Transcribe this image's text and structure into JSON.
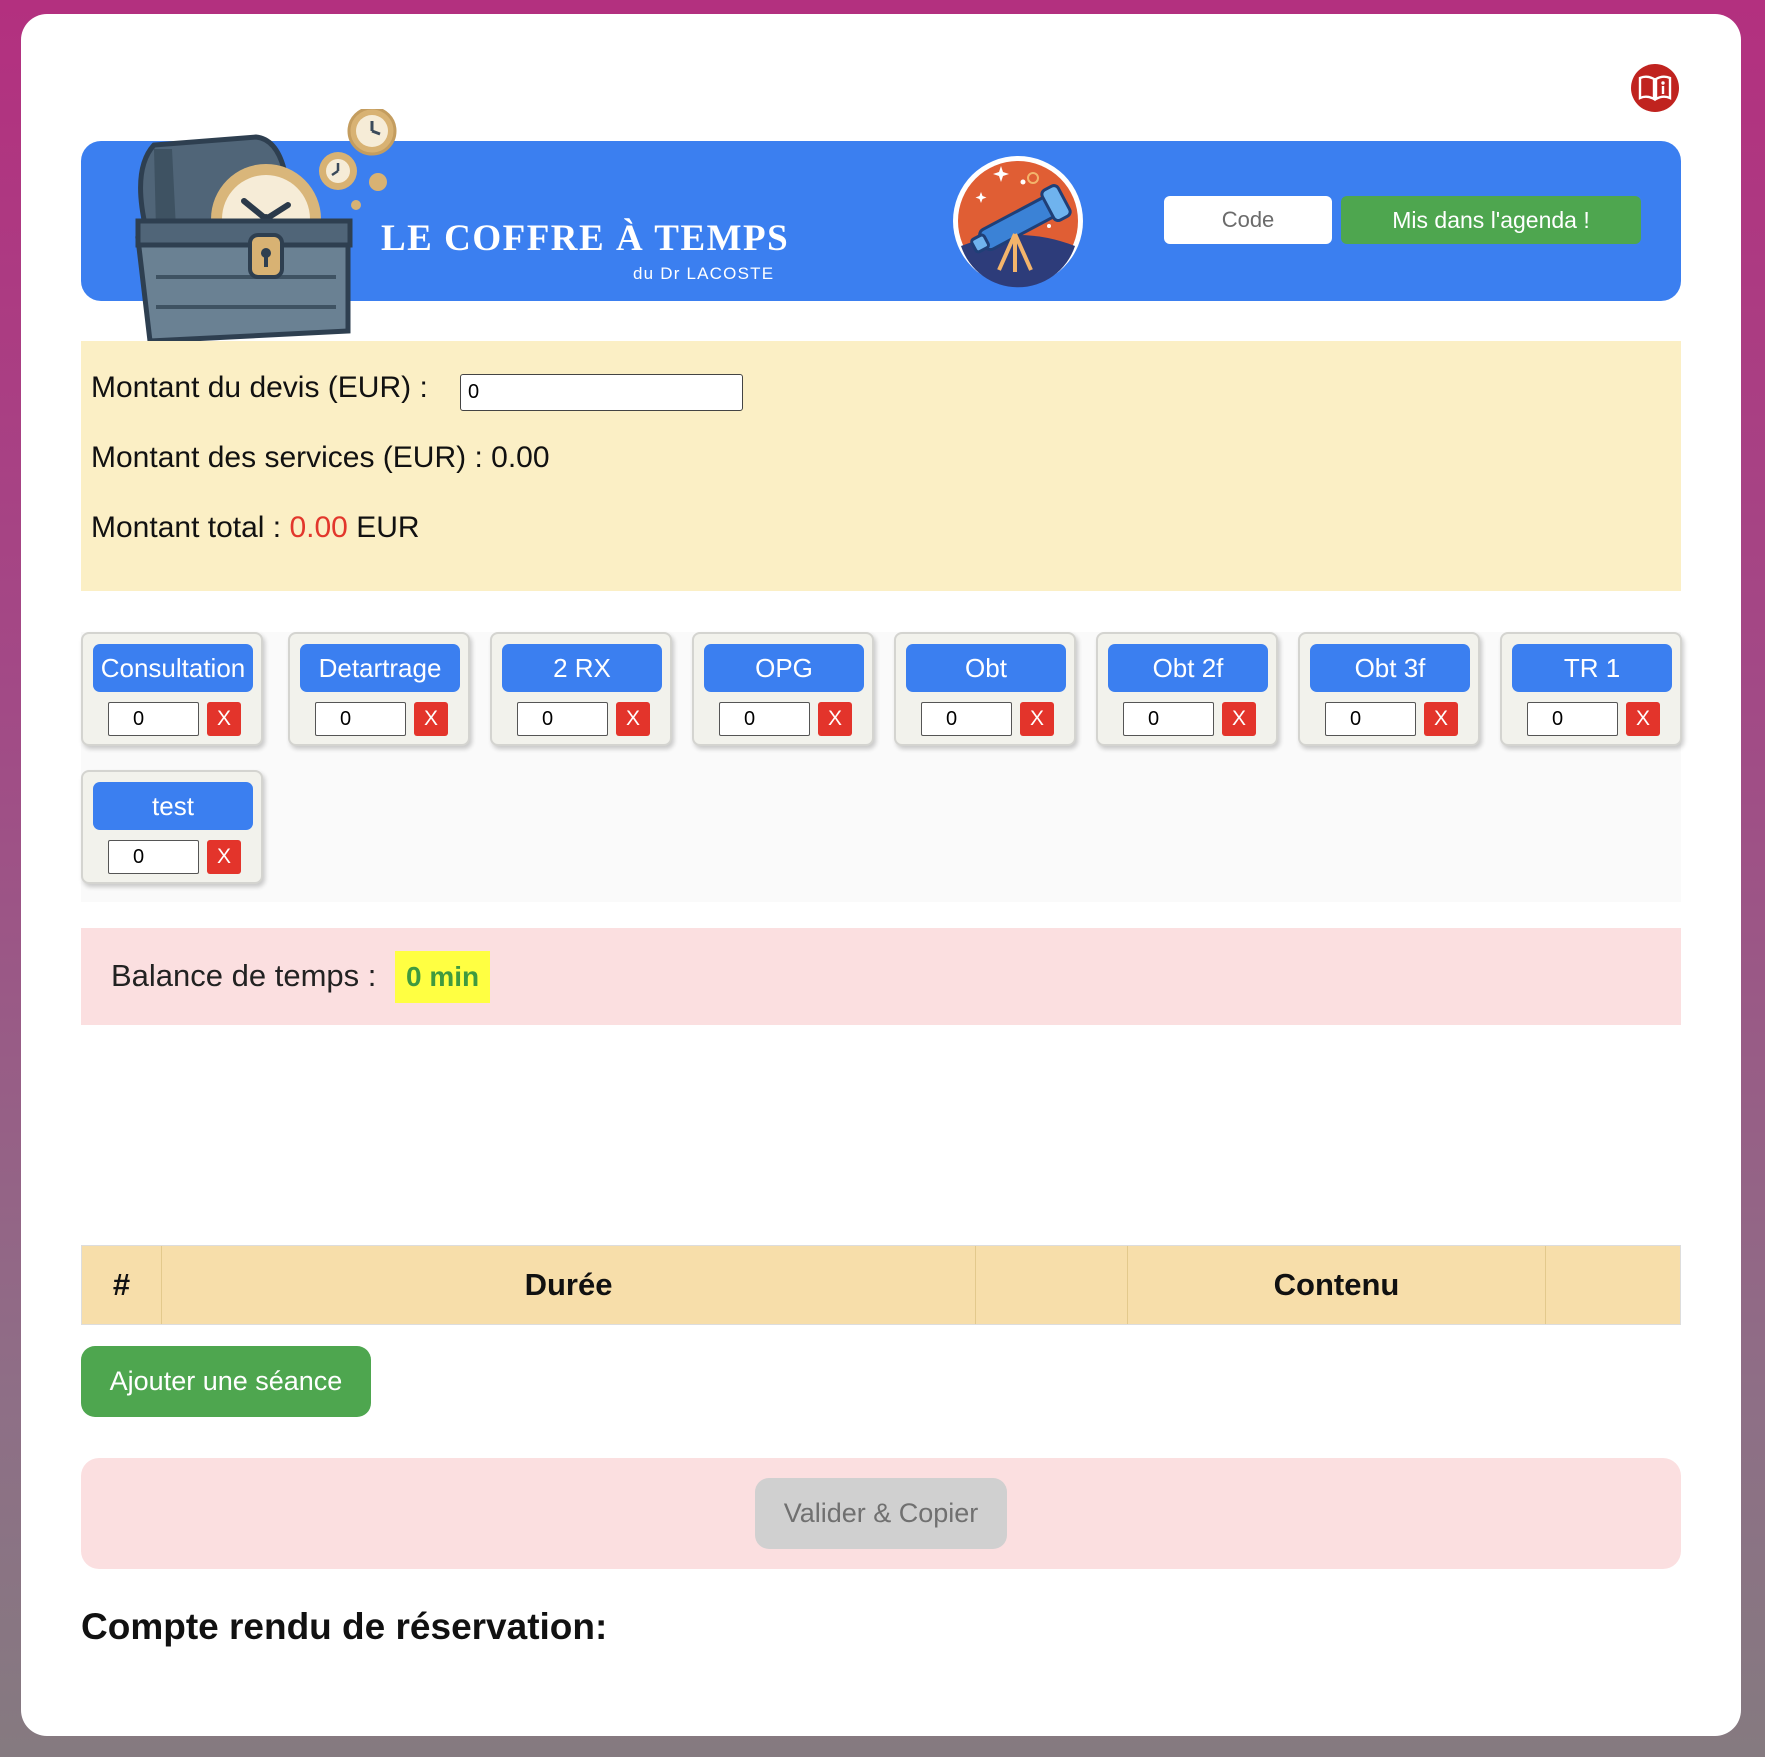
{
  "header": {
    "title": "LE COFFRE À TEMPS",
    "subtitle": "du Dr LACOSTE",
    "code_placeholder": "Code",
    "agenda_button": "Mis dans l'agenda !"
  },
  "amounts": {
    "devis_label": "Montant du devis (EUR) :",
    "devis_value": "0",
    "services_label": "Montant des services (EUR) :",
    "services_value": "0.00",
    "total_label": "Montant total :",
    "total_value": "0.00",
    "total_unit": "EUR"
  },
  "services": [
    {
      "label": "Consultation",
      "qty": "0",
      "remove": "X"
    },
    {
      "label": "Detartrage",
      "qty": "0",
      "remove": "X"
    },
    {
      "label": "2 RX",
      "qty": "0",
      "remove": "X"
    },
    {
      "label": "OPG",
      "qty": "0",
      "remove": "X"
    },
    {
      "label": "Obt",
      "qty": "0",
      "remove": "X"
    },
    {
      "label": "Obt 2f",
      "qty": "0",
      "remove": "X"
    },
    {
      "label": "Obt 3f",
      "qty": "0",
      "remove": "X"
    },
    {
      "label": "TR 1",
      "qty": "0",
      "remove": "X"
    },
    {
      "label": "test",
      "qty": "0",
      "remove": "X"
    }
  ],
  "balance": {
    "label": "Balance de temps :",
    "value": "0 min"
  },
  "sessions_table": {
    "headers": [
      "#",
      "Durée",
      "",
      "Contenu",
      ""
    ]
  },
  "actions": {
    "add_session": "Ajouter une séance",
    "validate": "Valider & Copier"
  },
  "report": {
    "title": "Compte rendu de réservation:"
  },
  "colors": {
    "accent_blue": "#3b7ff0",
    "green": "#4ea64f",
    "red": "#e3342b",
    "info_icon_red": "#c0231f"
  },
  "icons": [
    "book-info-icon",
    "treasure-chest-clock-logo",
    "telescope-logo"
  ]
}
